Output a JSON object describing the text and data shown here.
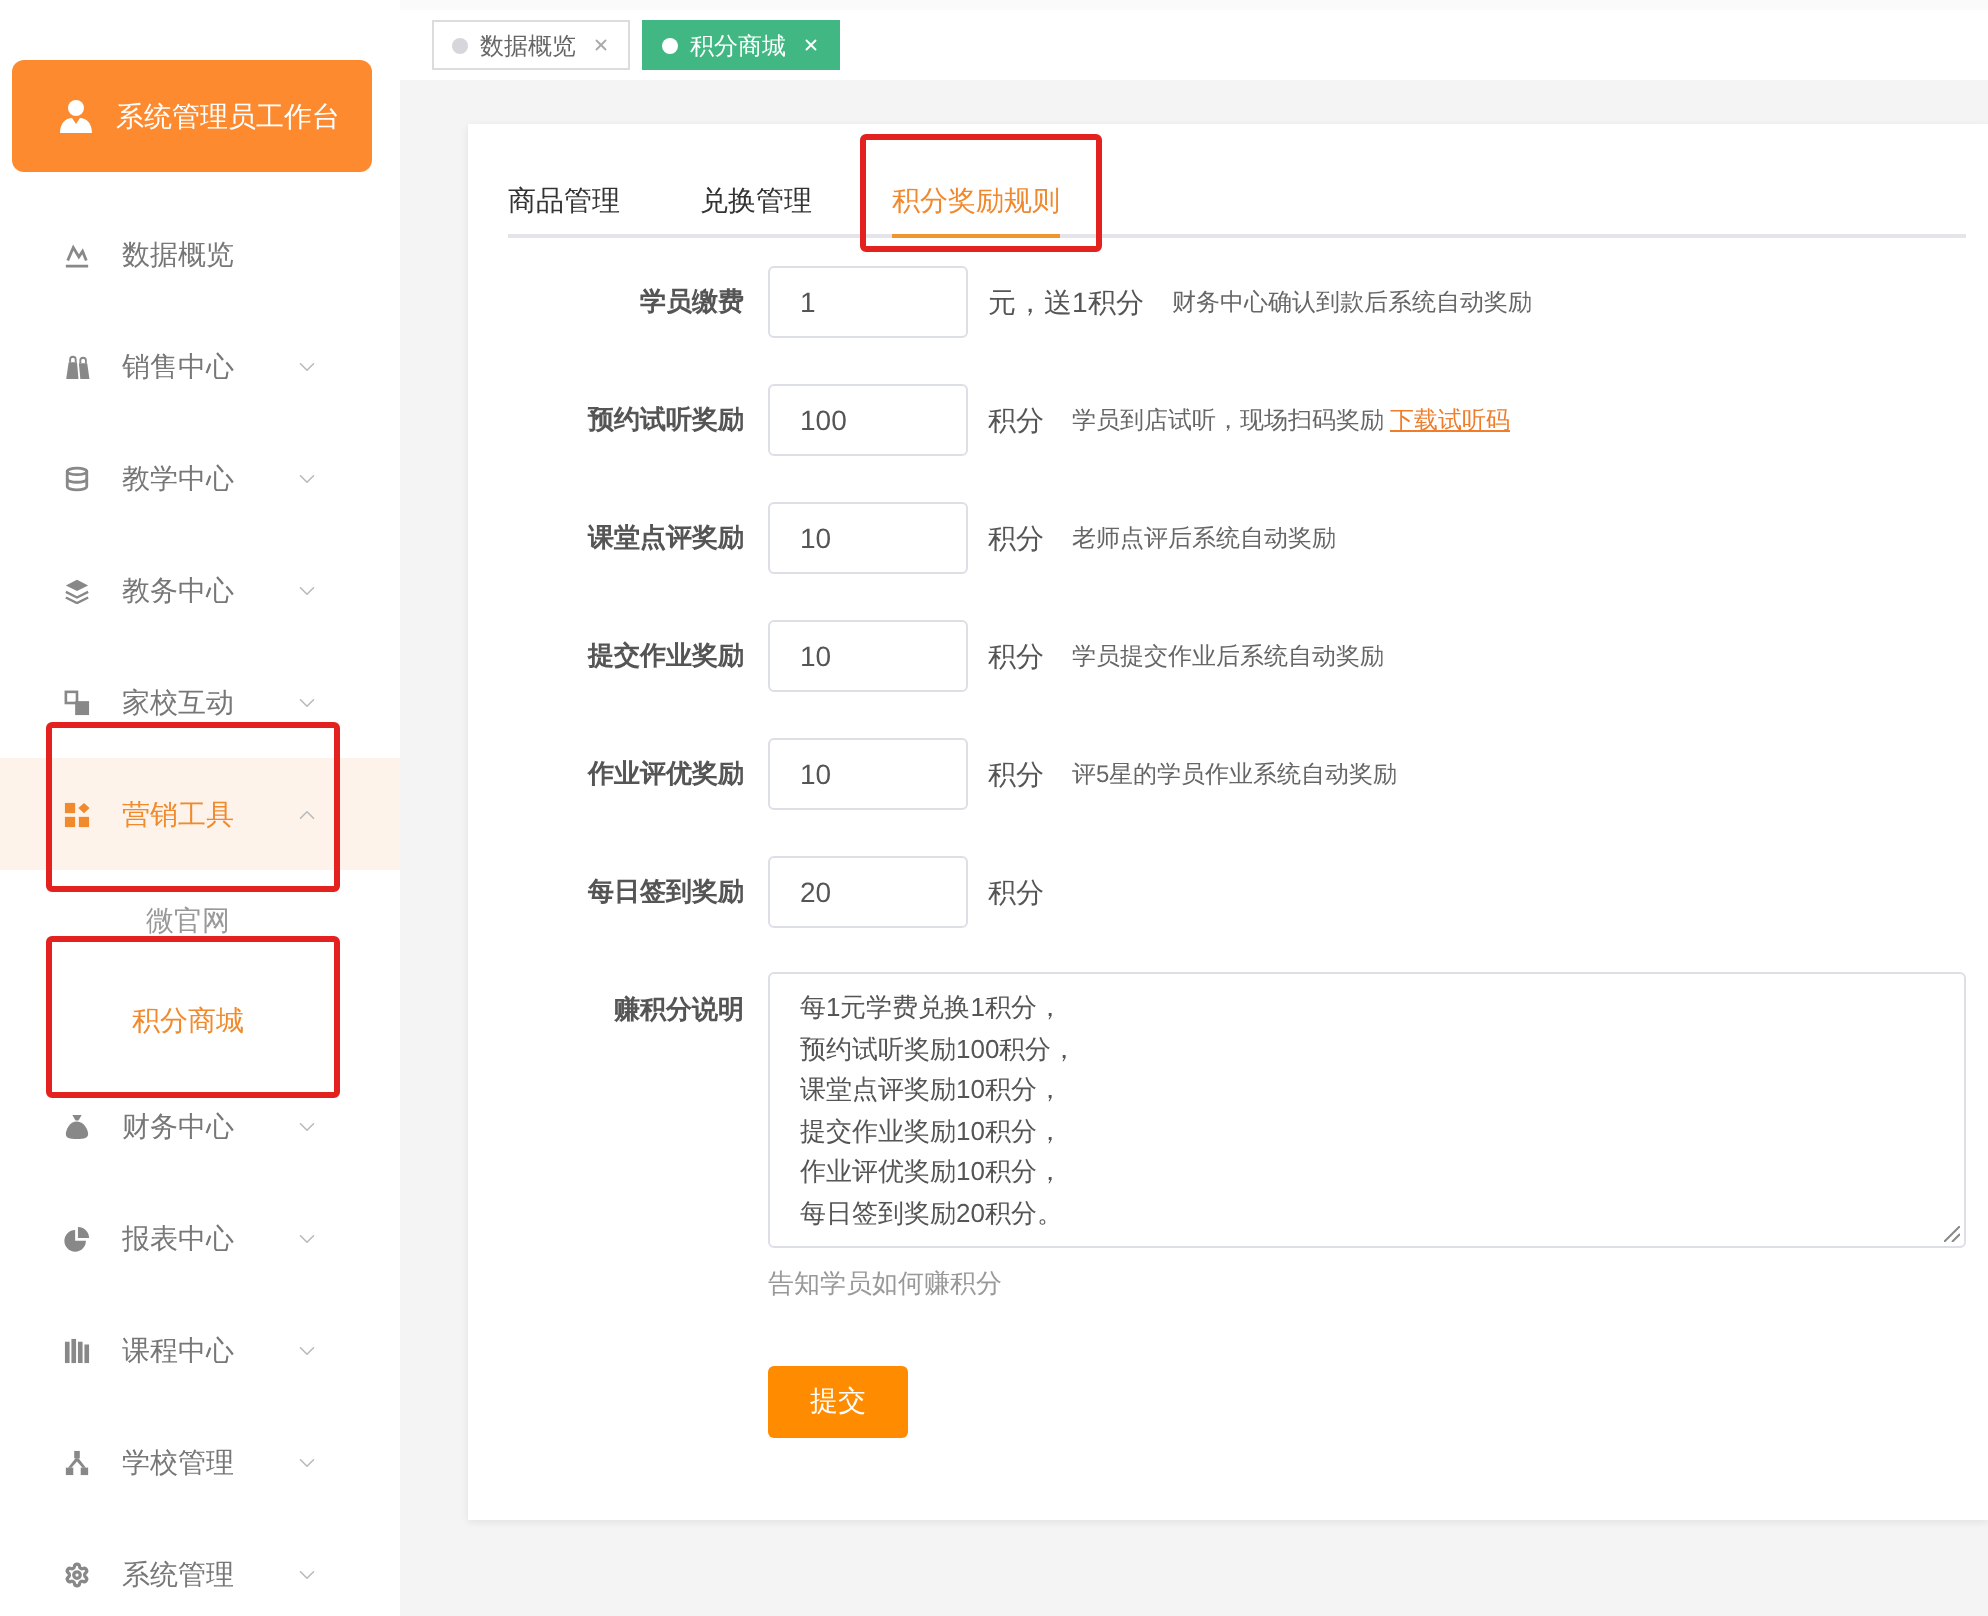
{
  "sidebar": {
    "header": "系统管理员工作台",
    "items": [
      {
        "label": "数据概览",
        "selected": false,
        "highlighted": false
      },
      {
        "label": "销售中心",
        "selected": false,
        "expanded": false,
        "highlighted": false
      },
      {
        "label": "教学中心",
        "selected": false,
        "expanded": false,
        "highlighted": false
      },
      {
        "label": "教务中心",
        "selected": false,
        "expanded": false,
        "highlighted": false
      },
      {
        "label": "家校互动",
        "selected": false,
        "expanded": false,
        "highlighted": false
      },
      {
        "label": "营销工具",
        "selected": true,
        "expanded": true,
        "highlighted": true,
        "children": [
          {
            "label": "微官网",
            "selected": false,
            "highlighted": false
          },
          {
            "label": "积分商城",
            "selected": true,
            "highlighted": true
          }
        ]
      },
      {
        "label": "财务中心",
        "selected": false,
        "expanded": false,
        "highlighted": false
      },
      {
        "label": "报表中心",
        "selected": false,
        "expanded": false,
        "highlighted": false
      },
      {
        "label": "课程中心",
        "selected": false,
        "expanded": false,
        "highlighted": false
      },
      {
        "label": "学校管理",
        "selected": false,
        "expanded": false,
        "highlighted": false
      },
      {
        "label": "系统管理",
        "selected": false,
        "expanded": false,
        "highlighted": false
      }
    ]
  },
  "tag_bar": {
    "tags": [
      {
        "label": "数据概览",
        "selected": false
      },
      {
        "label": "积分商城",
        "selected": true
      }
    ]
  },
  "card": {
    "tabs": [
      {
        "label": "商品管理",
        "selected": false,
        "highlighted": false
      },
      {
        "label": "兑换管理",
        "selected": false,
        "highlighted": false
      },
      {
        "label": "积分奖励规则",
        "selected": true,
        "highlighted": true
      }
    ],
    "rules": [
      {
        "label": "学员缴费",
        "value": "1",
        "unit": "元，送1积分",
        "hint": "财务中心确认到款后系统自动奖励"
      },
      {
        "label": "预约试听奖励",
        "value": "100",
        "unit": "积分",
        "hint": "学员到店试听，现场扫码奖励",
        "link": "下载试听码"
      },
      {
        "label": "课堂点评奖励",
        "value": "10",
        "unit": "积分",
        "hint": "老师点评后系统自动奖励"
      },
      {
        "label": "提交作业奖励",
        "value": "10",
        "unit": "积分",
        "hint": "学员提交作业后系统自动奖励"
      },
      {
        "label": "作业评优奖励",
        "value": "10",
        "unit": "积分",
        "hint": "评5星的学员作业系统自动奖励"
      },
      {
        "label": "每日签到奖励",
        "value": "20",
        "unit": "积分"
      }
    ],
    "description": {
      "label": "赚积分说明",
      "lines": [
        "每1元学费兑换1积分，",
        "预约试听奖励100积分，",
        "课堂点评奖励10积分，",
        "提交作业奖励10积分，",
        "作业评优奖励10积分，",
        "每日签到奖励20积分。"
      ],
      "helper": "告知学员如何赚积分"
    },
    "submit": "提交"
  }
}
